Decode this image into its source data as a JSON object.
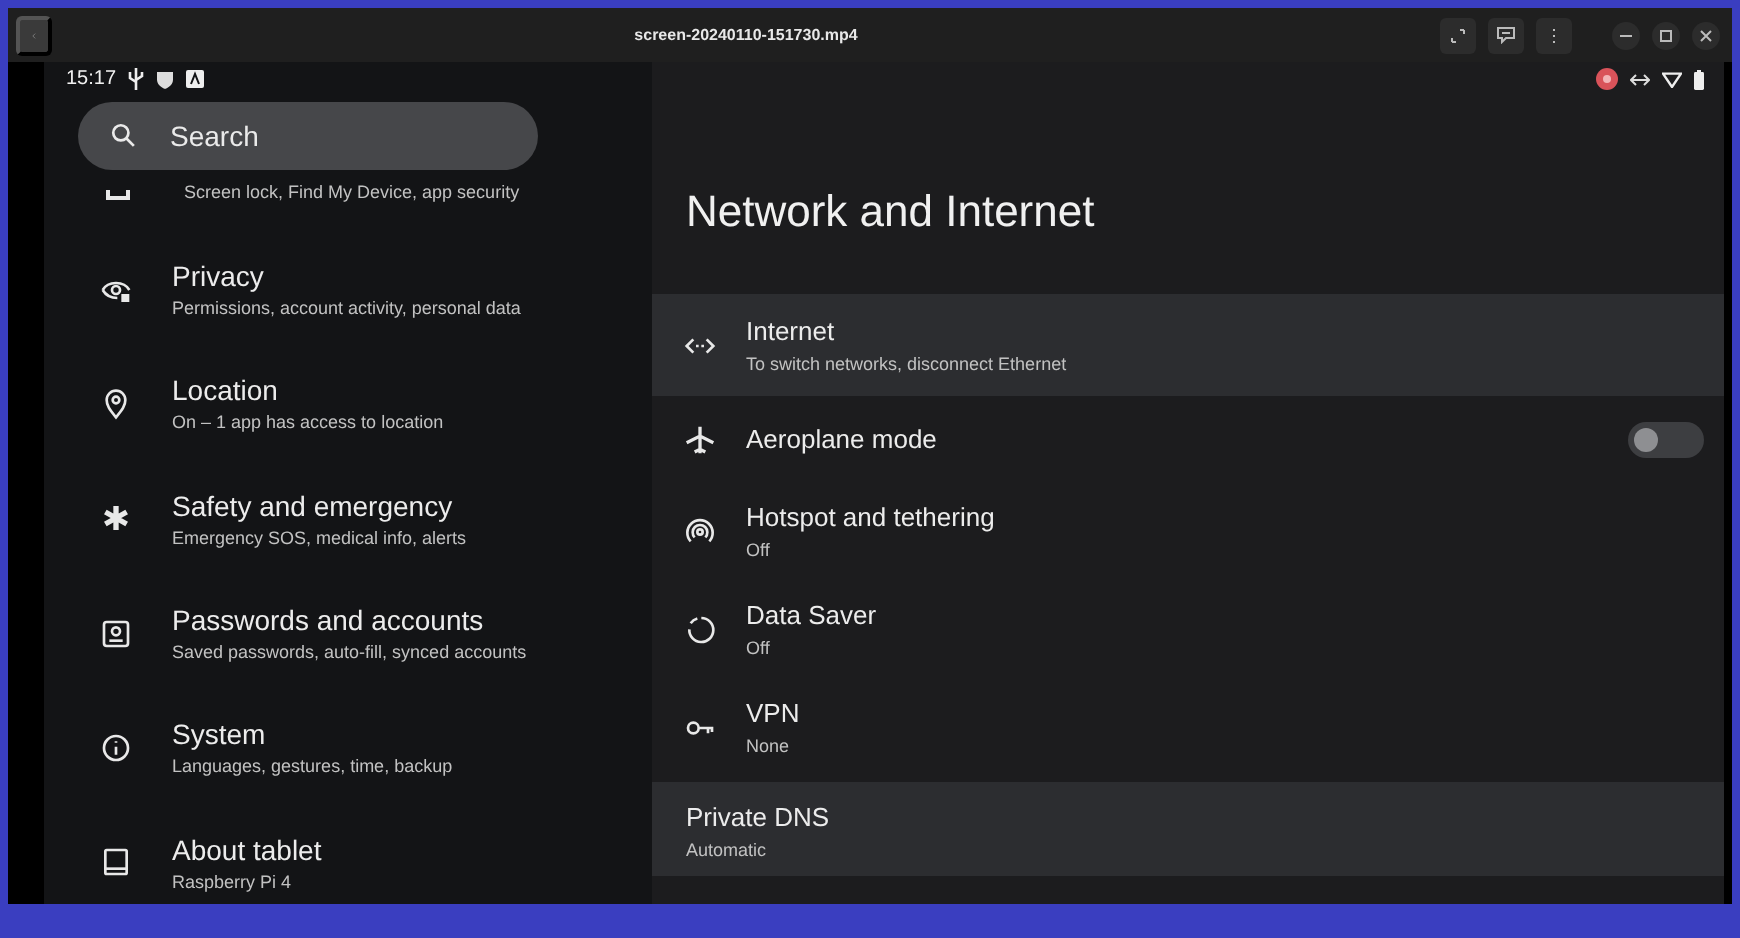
{
  "window": {
    "title": "screen-20240110-151730.mp4"
  },
  "status_bar": {
    "time": "15:17"
  },
  "search": {
    "placeholder": "Search"
  },
  "sidebar": {
    "items": [
      {
        "kind": "lock",
        "subtitle": "Screen lock, Find My Device, app security"
      },
      {
        "kind": "privacy",
        "title": "Privacy",
        "subtitle": "Permissions, account activity, personal data"
      },
      {
        "kind": "location",
        "title": "Location",
        "subtitle": "On – 1 app has access to location"
      },
      {
        "kind": "safety",
        "title": "Safety and emergency",
        "subtitle": "Emergency SOS, medical info, alerts"
      },
      {
        "kind": "passwords",
        "title": "Passwords and accounts",
        "subtitle": "Saved passwords, auto-fill, synced accounts"
      },
      {
        "kind": "system",
        "title": "System",
        "subtitle": "Languages, gestures, time, backup"
      },
      {
        "kind": "about",
        "title": "About tablet",
        "subtitle": "Raspberry Pi 4"
      }
    ]
  },
  "page": {
    "title": "Network and Internet",
    "items": [
      {
        "kind": "ethernet",
        "title": "Internet",
        "subtitle": "To switch networks, disconnect Ethernet",
        "selected": true
      },
      {
        "kind": "airplane",
        "title": "Aeroplane mode",
        "toggle": {
          "on": false
        },
        "selected": false
      },
      {
        "kind": "hotspot",
        "title": "Hotspot and tethering",
        "subtitle": "Off",
        "selected": false
      },
      {
        "kind": "datasaver",
        "title": "Data Saver",
        "subtitle": "Off",
        "selected": false
      },
      {
        "kind": "vpn",
        "title": "VPN",
        "subtitle": "None",
        "selected": false
      },
      {
        "kind": "none",
        "title": "Private DNS",
        "subtitle": "Automatic",
        "selected": true
      }
    ]
  }
}
